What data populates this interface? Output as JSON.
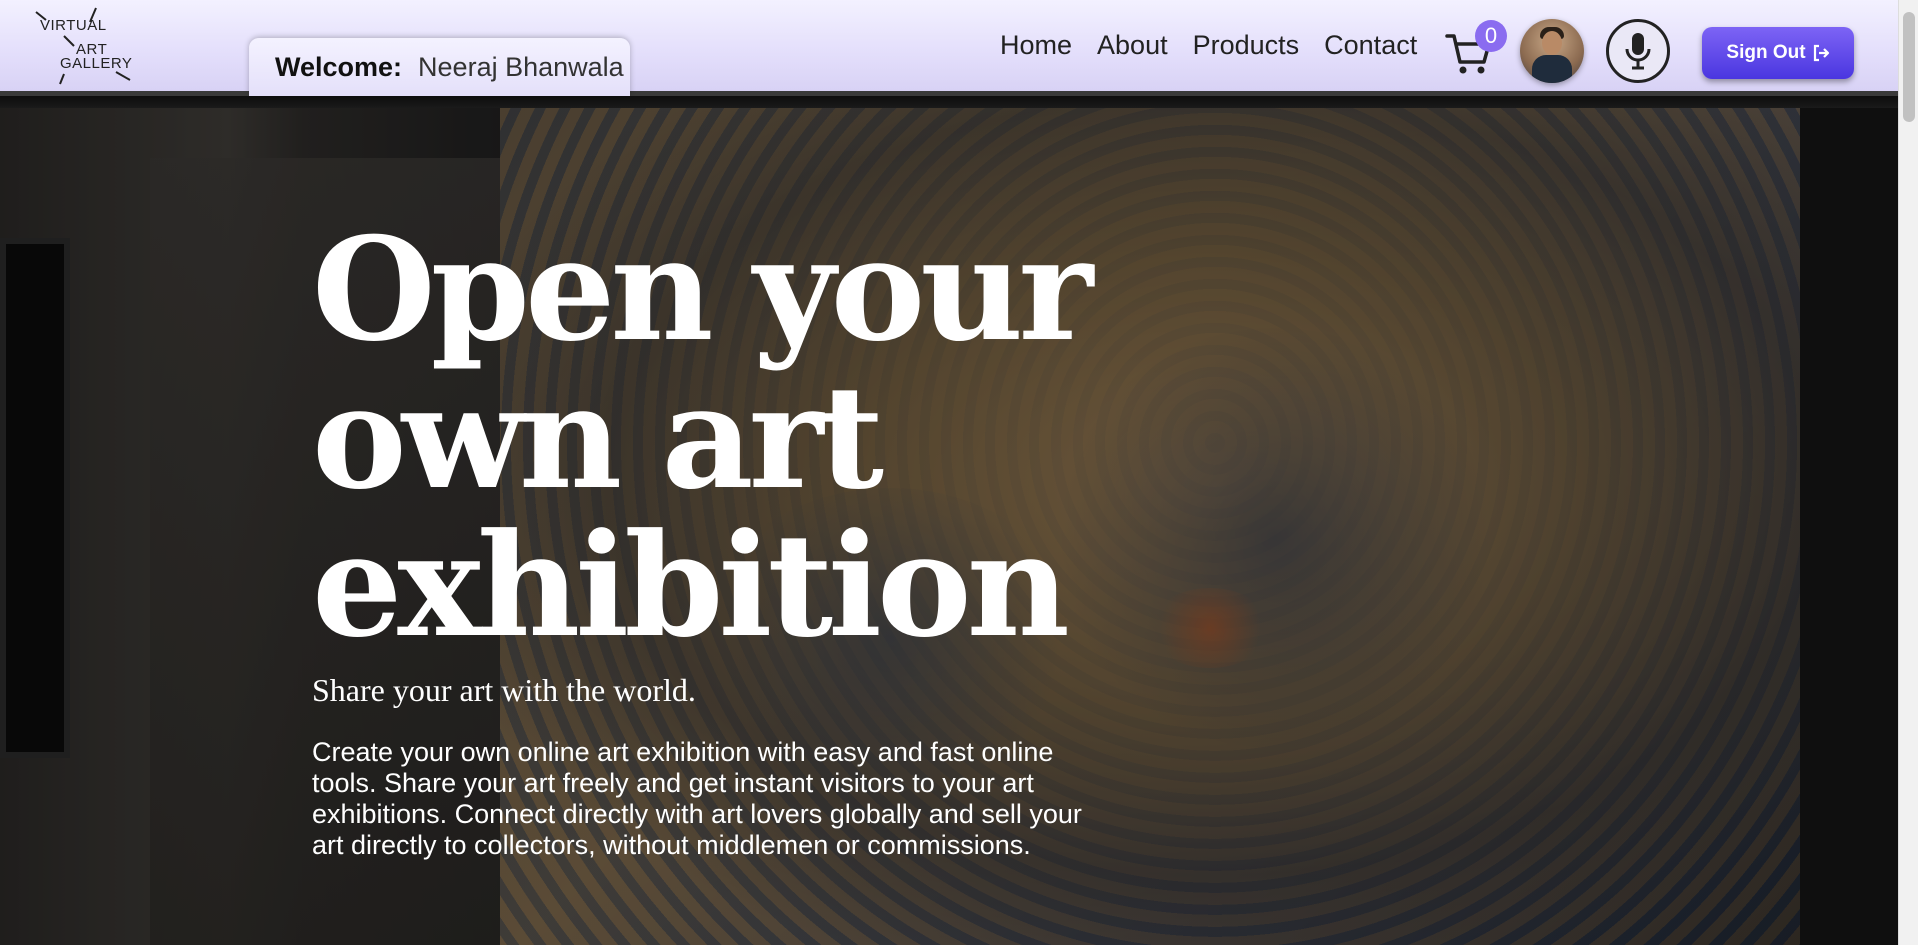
{
  "brand": {
    "logo_line1": "VIRTUAL",
    "logo_line2": "ART",
    "logo_line3": "GALLERY"
  },
  "welcome": {
    "label": "Welcome:",
    "name": "Neeraj Bhanwala"
  },
  "nav": {
    "items": [
      {
        "label": "Home"
      },
      {
        "label": "About"
      },
      {
        "label": "Products"
      },
      {
        "label": "Contact"
      }
    ]
  },
  "cart": {
    "count": "0",
    "icon": "cart-icon"
  },
  "mic": {
    "icon": "microphone-icon"
  },
  "signout": {
    "label": "Sign Out",
    "icon": "sign-out-icon"
  },
  "hero": {
    "title_line1": "Open your",
    "title_line2": "own art",
    "title_line3": "exhibition",
    "subtitle": "Share your art with the world.",
    "description": "Create your own online art exhibition with easy and fast online tools. Share your art freely and get instant visitors to your art exhibitions. Connect directly with art lovers globally and sell your art directly to collectors, without middlemen or commissions."
  },
  "colors": {
    "header_bg": "#e3defb",
    "accent": "#5a44e6",
    "badge": "#8a6cf0"
  }
}
